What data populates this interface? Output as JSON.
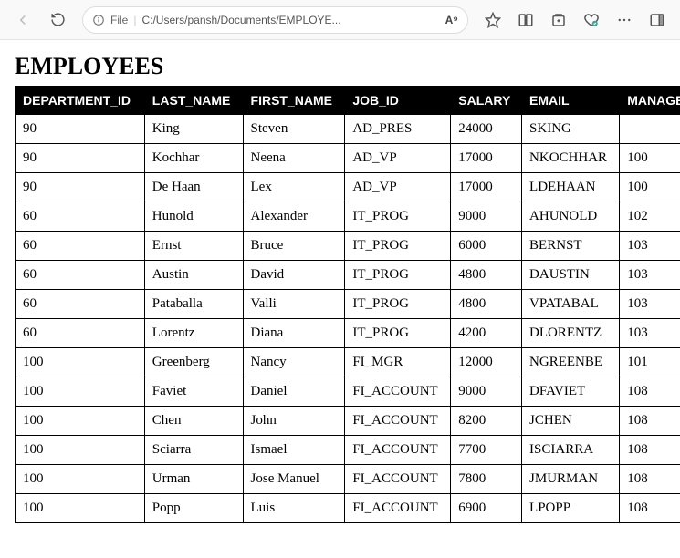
{
  "toolbar": {
    "file_label": "File",
    "path": "C:/Users/pansh/Documents/EMPLOYE...",
    "reader_badge": "A⁹"
  },
  "page": {
    "title": "EMPLOYEES"
  },
  "table": {
    "columns": [
      "DEPARTMENT_ID",
      "LAST_NAME",
      "FIRST_NAME",
      "JOB_ID",
      "SALARY",
      "EMAIL",
      "MANAGER_ID"
    ],
    "rows": [
      {
        "DEPARTMENT_ID": "90",
        "LAST_NAME": "King",
        "FIRST_NAME": "Steven",
        "JOB_ID": "AD_PRES",
        "SALARY": "24000",
        "EMAIL": "SKING",
        "MANAGER_ID": ""
      },
      {
        "DEPARTMENT_ID": "90",
        "LAST_NAME": "Kochhar",
        "FIRST_NAME": "Neena",
        "JOB_ID": "AD_VP",
        "SALARY": "17000",
        "EMAIL": "NKOCHHAR",
        "MANAGER_ID": "100"
      },
      {
        "DEPARTMENT_ID": "90",
        "LAST_NAME": "De Haan",
        "FIRST_NAME": "Lex",
        "JOB_ID": "AD_VP",
        "SALARY": "17000",
        "EMAIL": "LDEHAAN",
        "MANAGER_ID": "100"
      },
      {
        "DEPARTMENT_ID": "60",
        "LAST_NAME": "Hunold",
        "FIRST_NAME": "Alexander",
        "JOB_ID": "IT_PROG",
        "SALARY": "9000",
        "EMAIL": "AHUNOLD",
        "MANAGER_ID": "102"
      },
      {
        "DEPARTMENT_ID": "60",
        "LAST_NAME": "Ernst",
        "FIRST_NAME": "Bruce",
        "JOB_ID": "IT_PROG",
        "SALARY": "6000",
        "EMAIL": "BERNST",
        "MANAGER_ID": "103"
      },
      {
        "DEPARTMENT_ID": "60",
        "LAST_NAME": "Austin",
        "FIRST_NAME": "David",
        "JOB_ID": "IT_PROG",
        "SALARY": "4800",
        "EMAIL": "DAUSTIN",
        "MANAGER_ID": "103"
      },
      {
        "DEPARTMENT_ID": "60",
        "LAST_NAME": "Pataballa",
        "FIRST_NAME": "Valli",
        "JOB_ID": "IT_PROG",
        "SALARY": "4800",
        "EMAIL": "VPATABAL",
        "MANAGER_ID": "103"
      },
      {
        "DEPARTMENT_ID": "60",
        "LAST_NAME": "Lorentz",
        "FIRST_NAME": "Diana",
        "JOB_ID": "IT_PROG",
        "SALARY": "4200",
        "EMAIL": "DLORENTZ",
        "MANAGER_ID": "103"
      },
      {
        "DEPARTMENT_ID": "100",
        "LAST_NAME": "Greenberg",
        "FIRST_NAME": "Nancy",
        "JOB_ID": "FI_MGR",
        "SALARY": "12000",
        "EMAIL": "NGREENBE",
        "MANAGER_ID": "101"
      },
      {
        "DEPARTMENT_ID": "100",
        "LAST_NAME": "Faviet",
        "FIRST_NAME": "Daniel",
        "JOB_ID": "FI_ACCOUNT",
        "SALARY": "9000",
        "EMAIL": "DFAVIET",
        "MANAGER_ID": "108"
      },
      {
        "DEPARTMENT_ID": "100",
        "LAST_NAME": "Chen",
        "FIRST_NAME": "John",
        "JOB_ID": "FI_ACCOUNT",
        "SALARY": "8200",
        "EMAIL": "JCHEN",
        "MANAGER_ID": "108"
      },
      {
        "DEPARTMENT_ID": "100",
        "LAST_NAME": "Sciarra",
        "FIRST_NAME": "Ismael",
        "JOB_ID": "FI_ACCOUNT",
        "SALARY": "7700",
        "EMAIL": "ISCIARRA",
        "MANAGER_ID": "108"
      },
      {
        "DEPARTMENT_ID": "100",
        "LAST_NAME": "Urman",
        "FIRST_NAME": "Jose Manuel",
        "JOB_ID": "FI_ACCOUNT",
        "SALARY": "7800",
        "EMAIL": "JMURMAN",
        "MANAGER_ID": "108"
      },
      {
        "DEPARTMENT_ID": "100",
        "LAST_NAME": "Popp",
        "FIRST_NAME": "Luis",
        "JOB_ID": "FI_ACCOUNT",
        "SALARY": "6900",
        "EMAIL": "LPOPP",
        "MANAGER_ID": "108"
      }
    ]
  }
}
